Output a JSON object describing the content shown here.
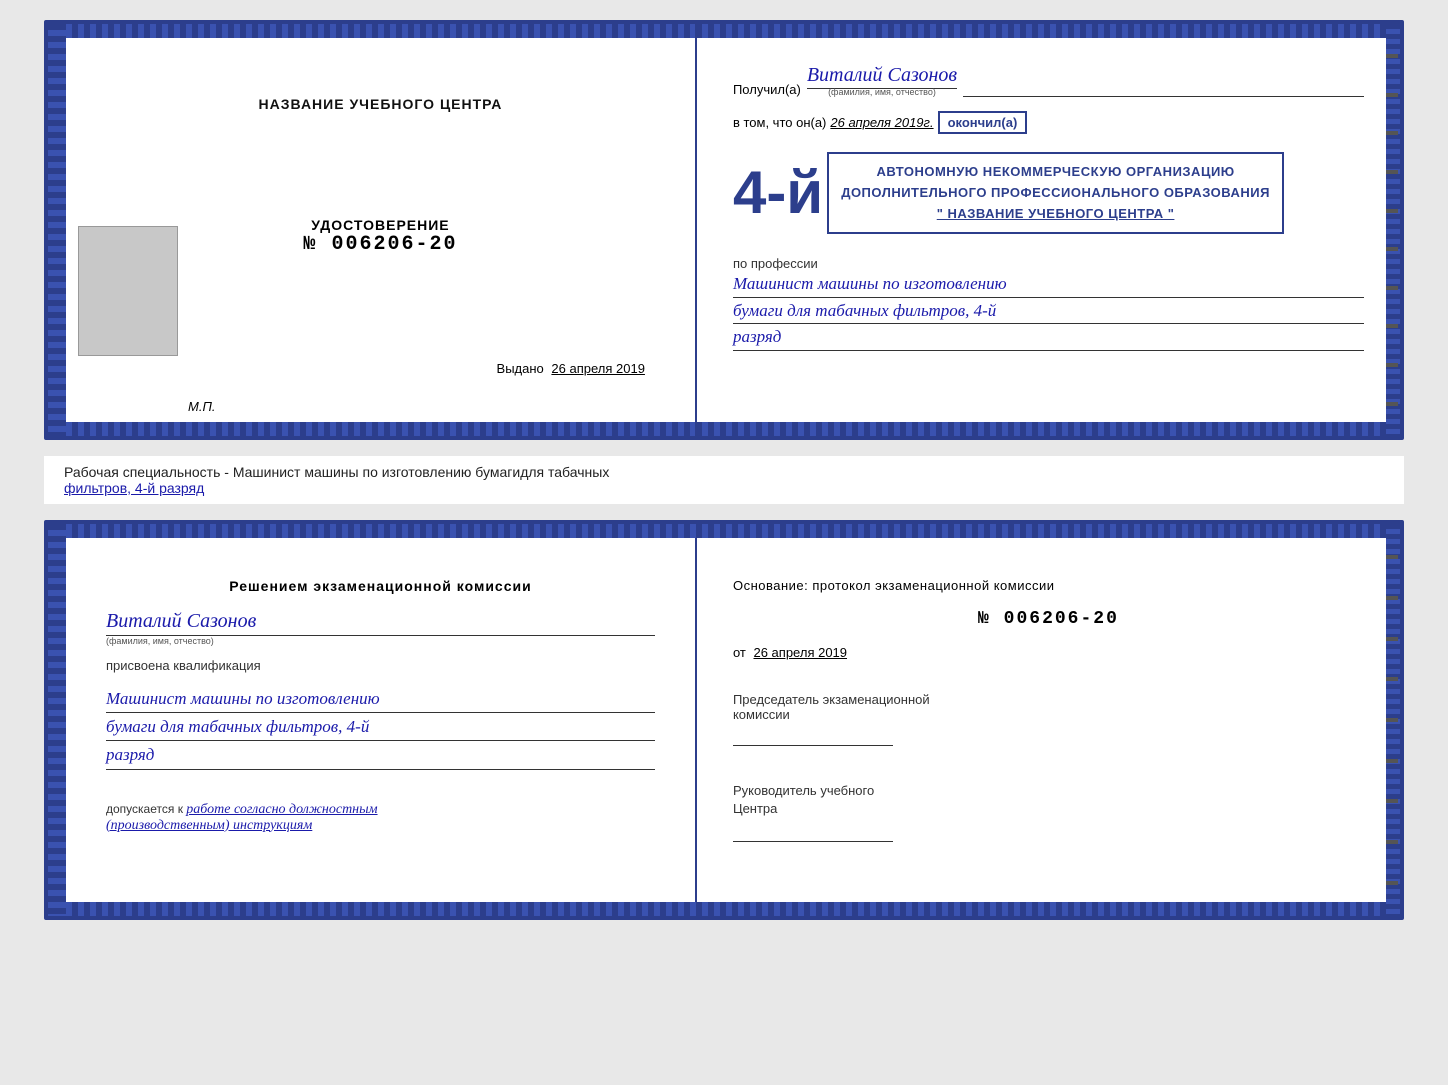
{
  "top_cert": {
    "left": {
      "title": "НАЗВАНИЕ УЧЕБНОГО ЦЕНТРА",
      "udostoverenie_label": "УДОСТОВЕРЕНИЕ",
      "number_prefix": "№",
      "number": "006206-20",
      "issued_label": "Выдано",
      "issued_date": "26 апреля 2019",
      "mp_label": "М.П."
    },
    "right": {
      "poluchil_prefix": "Получил(а)",
      "recipient_name": "Виталий Сазонов",
      "recipient_sub": "(фамилия, имя, отчество)",
      "vtom_text": "в том, что он(а)",
      "date_italic": "26 апреля 2019г.",
      "okonchil": "окончил(а)",
      "big_number": "4-й",
      "org_line1": "АВТОНОМНУЮ НЕКОММЕРЧЕСКУЮ ОРГАНИЗАЦИЮ",
      "org_line2": "ДОПОЛНИТЕЛЬНОГО ПРОФЕССИОНАЛЬНОГО ОБРАЗОВАНИЯ",
      "org_name": "\" НАЗВАНИЕ УЧЕБНОГО ЦЕНТРА \"",
      "profession_label": "по профессии",
      "profession_line1": "Машинист машины по изготовлению",
      "profession_line2": "бумаги для табачных фильтров, 4-й",
      "profession_line3": "разряд"
    }
  },
  "middle_label": {
    "text_prefix": "Рабочая специальность - Машинист машины по изготовлению бумагидля табачных",
    "text_underline": "фильтров, 4-й разряд"
  },
  "bottom_cert": {
    "left": {
      "decision_title": "Решением  экзаменационной  комиссии",
      "name": "Виталий Сазонов",
      "name_sub": "(фамилия, имя, отчество)",
      "assigned_label": "присвоена квалификация",
      "qualification_line1": "Машинист машины по изготовлению",
      "qualification_line2": "бумаги для табачных фильтров, 4-й",
      "qualification_line3": "разряд",
      "допускается_label": "допускается к",
      "допускается_value": "работе согласно должностным",
      "допускается_value2": "(производственным) инструкциям"
    },
    "right": {
      "basis_label": "Основание: протокол экзаменационной  комиссии",
      "number_prefix": "№",
      "number": "006206-20",
      "date_prefix": "от",
      "date": "26 апреля 2019",
      "chairman_label": "Председатель экзаменационной",
      "chairman_label2": "комиссии",
      "head_label": "Руководитель учебного",
      "head_label2": "Центра"
    }
  }
}
